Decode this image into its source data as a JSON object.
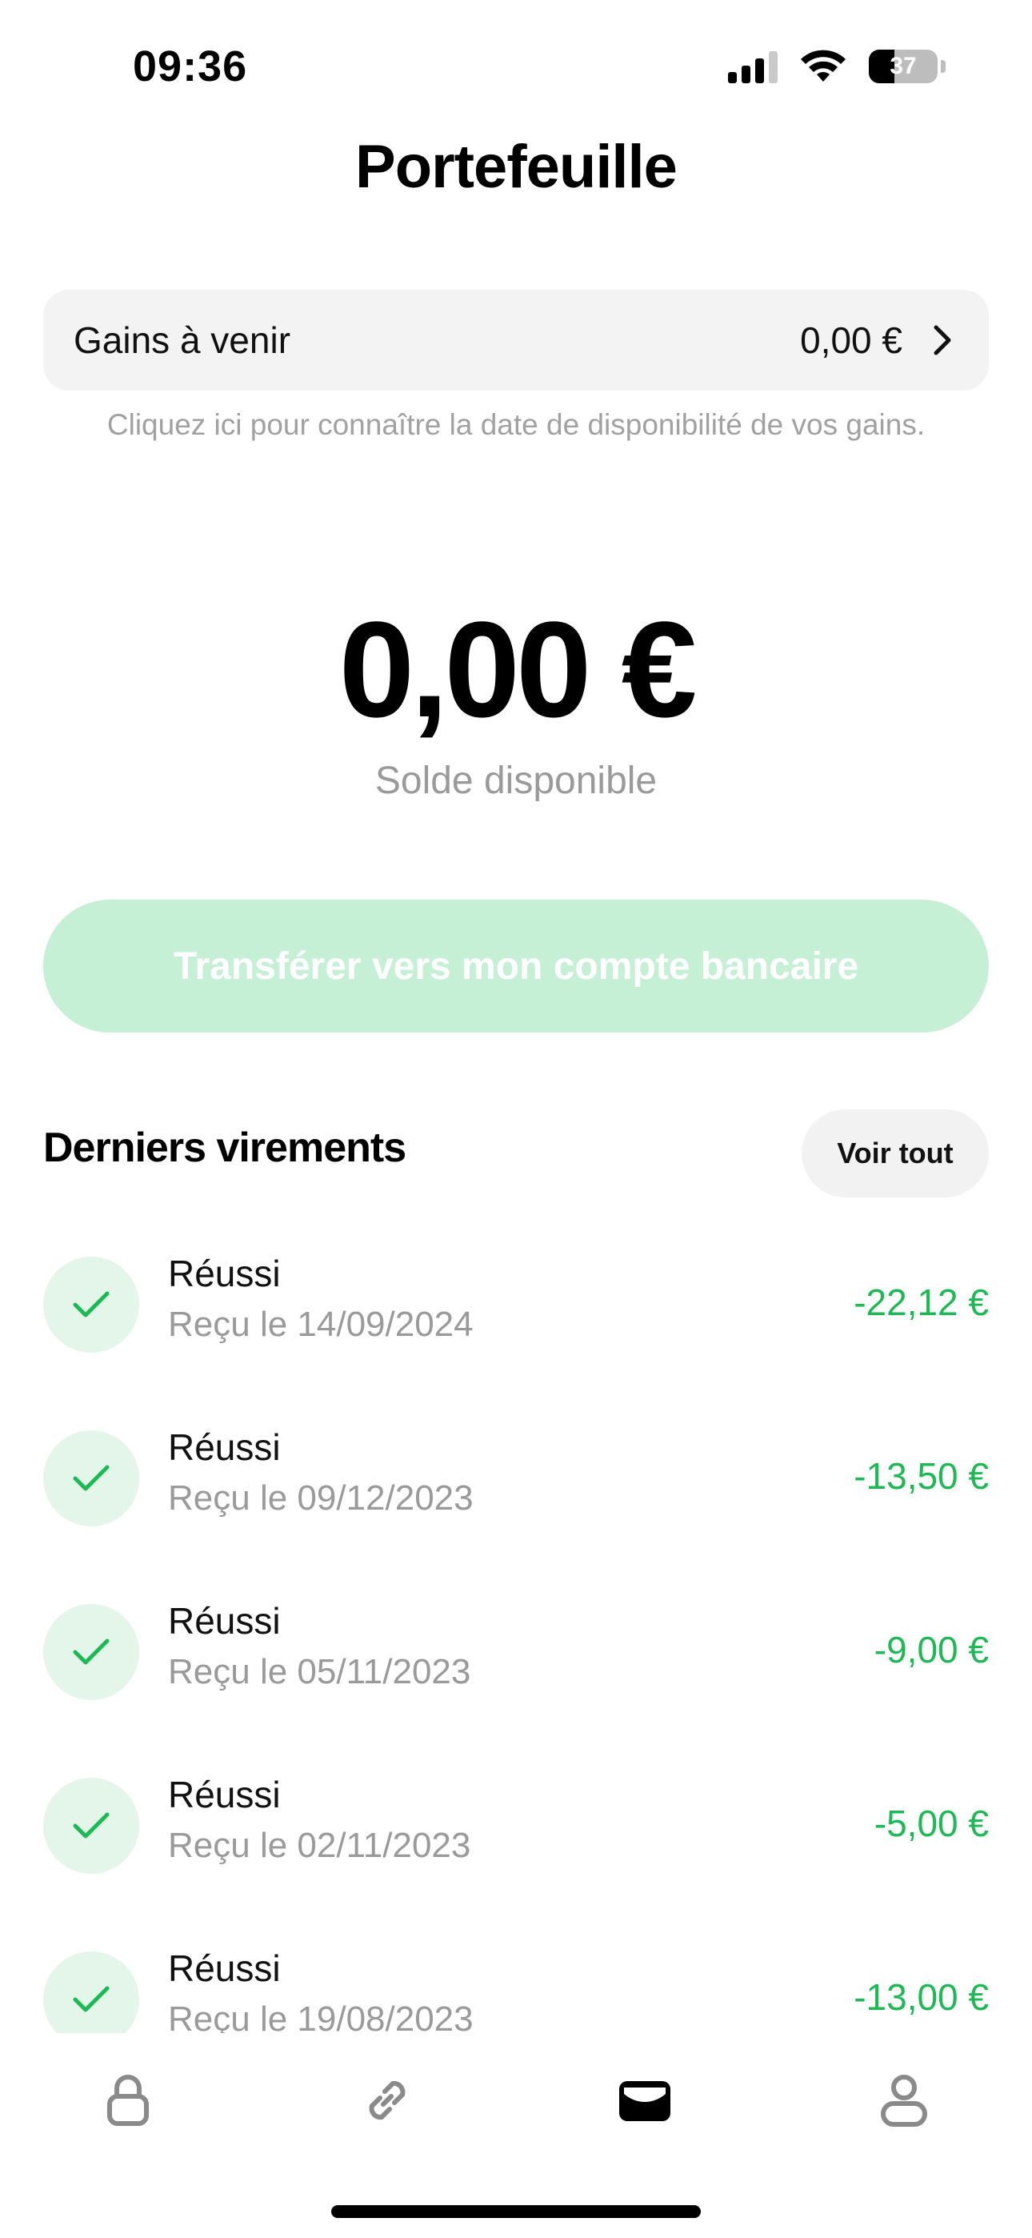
{
  "status_bar": {
    "time": "09:36",
    "battery": "37",
    "battery_level": 0.37
  },
  "page": {
    "title": "Portefeuille"
  },
  "gains": {
    "label": "Gains à venir",
    "value": "0,00 €",
    "hint": "Cliquez ici pour connaître la date de disponibilité de vos gains."
  },
  "balance": {
    "amount": "0,00 €",
    "label": "Solde disponible"
  },
  "transfer_button": {
    "label": "Transférer vers mon compte bancaire"
  },
  "transfers": {
    "title": "Derniers virements",
    "see_all": "Voir tout",
    "items": [
      {
        "status": "Réussi",
        "date": "Reçu le 14/09/2024",
        "amount": "-22,12 €"
      },
      {
        "status": "Réussi",
        "date": "Reçu le 09/12/2023",
        "amount": "-13,50 €"
      },
      {
        "status": "Réussi",
        "date": "Reçu le 05/11/2023",
        "amount": "-9,00 €"
      },
      {
        "status": "Réussi",
        "date": "Reçu le 02/11/2023",
        "amount": "-5,00 €"
      },
      {
        "status": "Réussi",
        "date": "Reçu le 19/08/2023",
        "amount": "-13,00 €"
      }
    ]
  },
  "tab_bar": {
    "items": [
      {
        "icon": "lock-icon",
        "active": false
      },
      {
        "icon": "link-icon",
        "active": false
      },
      {
        "icon": "wallet-icon",
        "active": true
      },
      {
        "icon": "user-icon",
        "active": false
      }
    ]
  },
  "colors": {
    "accent_green": "#1db954",
    "button_disabled": "#c6f0d5",
    "check_bg": "#e4f6ea",
    "card_bg": "#f3f3f3"
  }
}
